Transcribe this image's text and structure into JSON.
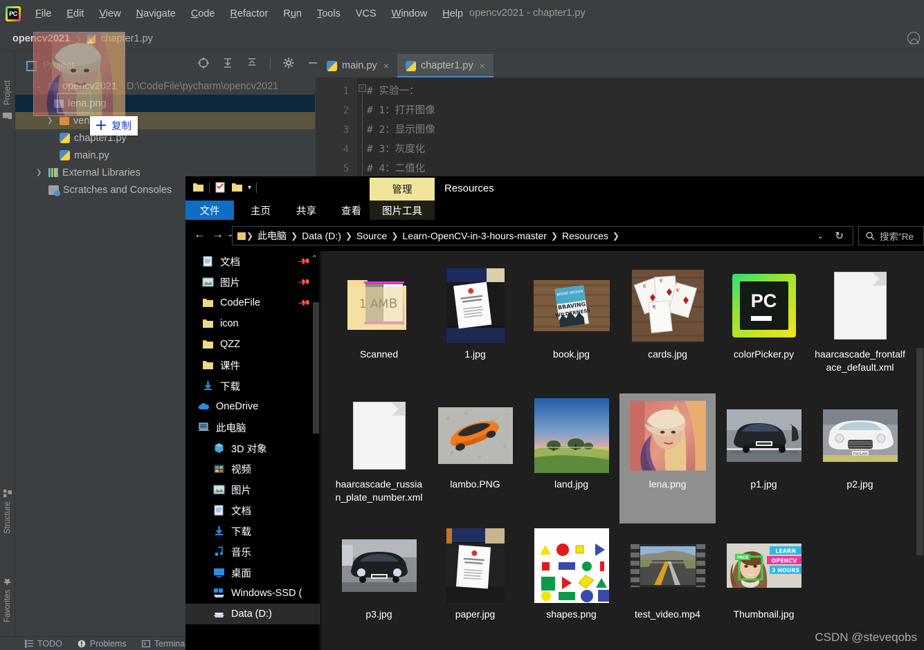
{
  "ide": {
    "title": "opencv2021 - chapter1.py",
    "logo_text": "PC",
    "menu": [
      {
        "label": "File"
      },
      {
        "label": "Edit"
      },
      {
        "label": "View"
      },
      {
        "label": "Navigate"
      },
      {
        "label": "Code"
      },
      {
        "label": "Refactor"
      },
      {
        "label": "Run"
      },
      {
        "label": "Tools"
      },
      {
        "label": "VCS"
      },
      {
        "label": "Window"
      },
      {
        "label": "Help"
      }
    ],
    "breadcrumb": {
      "project": "opencv2021",
      "file": "chapter1.py"
    },
    "project_panel_label": "Project",
    "tool_tabs": {
      "project": "Project",
      "structure": "Structure",
      "favorites": "Favorites"
    },
    "editor_tabs": [
      {
        "label": "main.py",
        "active": false
      },
      {
        "label": "chapter1.py",
        "active": true
      }
    ],
    "tree": [
      {
        "label": "opencv2021",
        "path": "D:\\CodeFile\\pycharm\\opencv2021",
        "icon": "folder-root",
        "arrow": "chevron-down",
        "indent": 0,
        "state": "none"
      },
      {
        "label": "lena.png",
        "icon": "image",
        "arrow": "",
        "indent": 1,
        "state": "selected"
      },
      {
        "label": "venv",
        "icon": "folder",
        "arrow": "chevron-right",
        "indent": 1,
        "state": "droptarget"
      },
      {
        "label": "chapter1.py",
        "icon": "python",
        "arrow": "",
        "indent": 1,
        "state": "none"
      },
      {
        "label": "main.py",
        "icon": "python",
        "arrow": "",
        "indent": 1,
        "state": "none"
      },
      {
        "label": "External Libraries",
        "icon": "library",
        "arrow": "chevron-right",
        "indent": 0,
        "state": "none"
      },
      {
        "label": "Scratches and Consoles",
        "icon": "scratch",
        "arrow": "",
        "indent": 0,
        "state": "none"
      }
    ],
    "code_lines": [
      {
        "num": "1",
        "text": "# 实验一："
      },
      {
        "num": "2",
        "text": "# 1：打开图像"
      },
      {
        "num": "3",
        "text": "# 2：显示图像"
      },
      {
        "num": "4",
        "text": "# 3：灰度化"
      },
      {
        "num": "5",
        "text": "# 4：二值化"
      }
    ],
    "statusbar": [
      {
        "label": "TODO",
        "icon": "todo-icon"
      },
      {
        "label": "Problems",
        "icon": "problems-icon"
      },
      {
        "label": "Terminal",
        "icon": "terminal-icon"
      }
    ],
    "toolbar_icons": [
      "locate-icon",
      "expand-all-icon",
      "collapse-all-icon",
      "settings-gear-icon",
      "hide-icon"
    ]
  },
  "drag": {
    "tooltip_label": "复制",
    "tooltip_plus": "＋",
    "ghost_file": "lena.png"
  },
  "explorer": {
    "window_title": "Resources",
    "contextual_tab": "管理",
    "contextual_group": "图片工具",
    "ribbon_tabs": [
      {
        "label": "文件",
        "active": true
      },
      {
        "label": "主页",
        "active": false
      },
      {
        "label": "共享",
        "active": false
      },
      {
        "label": "查看",
        "active": false
      }
    ],
    "nav_buttons": {
      "back": "←",
      "forward": "→",
      "recent": "⌄",
      "up": "↑",
      "refresh": "↻",
      "dropdown": "⌄"
    },
    "breadcrumb": [
      "此电脑",
      "Data (D:)",
      "Source",
      "Learn-OpenCV-in-3-hours-master",
      "Resources"
    ],
    "search_placeholder": "搜索\"Re",
    "nav_items": [
      {
        "label": "文档",
        "icon": "documents-icon",
        "pinned": true,
        "indent": 1,
        "selected": false
      },
      {
        "label": "图片",
        "icon": "pictures-icon",
        "pinned": true,
        "indent": 1,
        "selected": false
      },
      {
        "label": "CodeFile",
        "icon": "folder-icon",
        "pinned": true,
        "indent": 1,
        "selected": false
      },
      {
        "label": "icon",
        "icon": "folder-icon",
        "pinned": false,
        "indent": 1,
        "selected": false
      },
      {
        "label": "QZZ",
        "icon": "folder-icon",
        "pinned": false,
        "indent": 1,
        "selected": false
      },
      {
        "label": "课件",
        "icon": "folder-icon",
        "pinned": false,
        "indent": 1,
        "selected": false
      },
      {
        "label": "下载",
        "icon": "downloads-icon",
        "pinned": false,
        "indent": 1,
        "selected": false
      },
      {
        "label": "OneDrive",
        "icon": "onedrive-icon",
        "pinned": false,
        "indent": 0,
        "selected": false
      },
      {
        "label": "此电脑",
        "icon": "thispc-icon",
        "pinned": false,
        "indent": 0,
        "selected": false
      },
      {
        "label": "3D 对象",
        "icon": "3dobjects-icon",
        "pinned": false,
        "indent": 1,
        "selected": false
      },
      {
        "label": "视频",
        "icon": "videos-icon",
        "pinned": false,
        "indent": 1,
        "selected": false
      },
      {
        "label": "图片",
        "icon": "pictures-icon",
        "pinned": false,
        "indent": 1,
        "selected": false
      },
      {
        "label": "文档",
        "icon": "documents-icon",
        "pinned": false,
        "indent": 1,
        "selected": false
      },
      {
        "label": "下载",
        "icon": "downloads-icon",
        "pinned": false,
        "indent": 1,
        "selected": false
      },
      {
        "label": "音乐",
        "icon": "music-icon",
        "pinned": false,
        "indent": 1,
        "selected": false
      },
      {
        "label": "桌面",
        "icon": "desktop-icon",
        "pinned": false,
        "indent": 1,
        "selected": false
      },
      {
        "label": "Windows-SSD (",
        "icon": "drive-icon",
        "pinned": false,
        "indent": 1,
        "selected": false
      },
      {
        "label": "Data (D:)",
        "icon": "disk-icon",
        "pinned": false,
        "indent": 1,
        "selected": true
      }
    ],
    "files": [
      {
        "name": "Scanned",
        "thumb": "folder-plate",
        "selected": false
      },
      {
        "name": "1.jpg",
        "thumb": "photo-paper-desk",
        "selected": false
      },
      {
        "name": "book.jpg",
        "thumb": "photo-book-wood",
        "selected": false
      },
      {
        "name": "cards.jpg",
        "thumb": "photo-cards",
        "selected": false
      },
      {
        "name": "colorPicker.py",
        "thumb": "pycharm-icon",
        "selected": false
      },
      {
        "name": "haarcascade_frontalface_default.xml",
        "thumb": "blank-document",
        "selected": false
      },
      {
        "name": "haarcascade_russian_plate_number.xml",
        "thumb": "blank-document",
        "selected": false
      },
      {
        "name": "lambo.PNG",
        "thumb": "photo-orange-car",
        "selected": false
      },
      {
        "name": "land.jpg",
        "thumb": "photo-landscape",
        "selected": false
      },
      {
        "name": "lena.png",
        "thumb": "photo-lena",
        "selected": true
      },
      {
        "name": "p1.jpg",
        "thumb": "photo-black-car",
        "selected": false
      },
      {
        "name": "p2.jpg",
        "thumb": "photo-white-car",
        "selected": false
      },
      {
        "name": "p3.jpg",
        "thumb": "photo-porsche",
        "selected": false
      },
      {
        "name": "paper.jpg",
        "thumb": "photo-paper-desk",
        "selected": false
      },
      {
        "name": "shapes.png",
        "thumb": "shapes-grid",
        "selected": false
      },
      {
        "name": "test_video.mp4",
        "thumb": "film-strip-road",
        "selected": false
      },
      {
        "name": "Thumbnail.jpg",
        "thumb": "thumbnail-opencv",
        "selected": false
      }
    ],
    "thumbnail_overlay": {
      "face_tag": "FACE",
      "line1": "LEARN",
      "line2": "OPENCV",
      "line3": "3 HOURS"
    },
    "scanned_plate_text": "1 AM B"
  },
  "watermark": "CSDN @steveqobs",
  "colors": {
    "ide_bg": "#3c3f41",
    "editor_bg": "#2b2b2b",
    "tree_selection": "#0d293e",
    "drop_target": "#5c5640",
    "explorer_bg": "#000000",
    "file_pane_bg": "#1f1f1f",
    "file_selection": "#8f8f8f",
    "ribbon_file_tab": "#0d6ec4",
    "contextual_tab": "#efe49a",
    "drop_tip_text": "#1a3fd0"
  }
}
